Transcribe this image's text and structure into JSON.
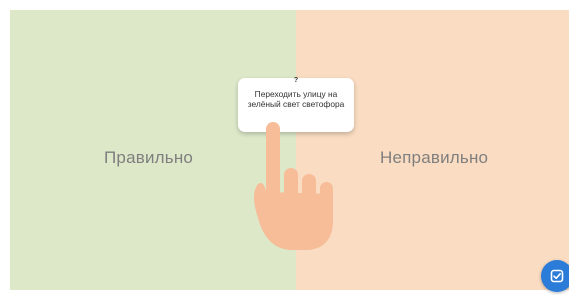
{
  "zones": {
    "left": {
      "label": "Правильно"
    },
    "right": {
      "label": "Неправильно"
    }
  },
  "card": {
    "question_mark": "?",
    "text": "Переходить улицу на зелёный свет светофора"
  },
  "icons": {
    "hand": "pointing-hand-icon",
    "check": "check-icon"
  },
  "colors": {
    "left_zone": "#dde8c9",
    "right_zone": "#f9dcc1",
    "hand": "#f7bc98",
    "check_button": "#2b7bd9"
  }
}
